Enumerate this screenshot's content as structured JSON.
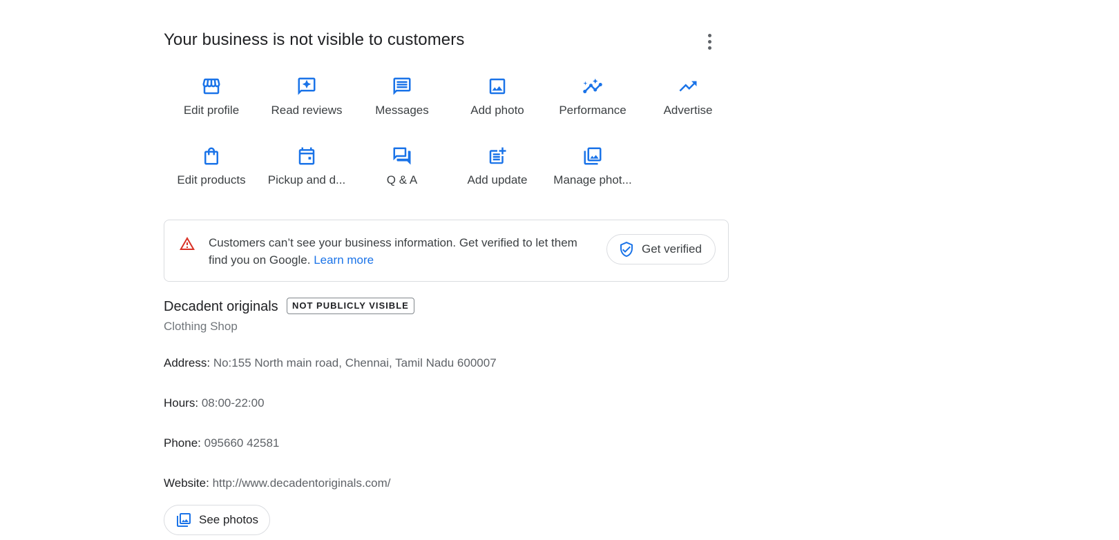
{
  "header": {
    "title": "Your business is not visible to customers",
    "more_icon": "more-vert-icon"
  },
  "actions": [
    {
      "label": "Edit profile",
      "icon": "storefront-icon"
    },
    {
      "label": "Read reviews",
      "icon": "review-star-icon"
    },
    {
      "label": "Messages",
      "icon": "message-icon"
    },
    {
      "label": "Add photo",
      "icon": "image-icon"
    },
    {
      "label": "Performance",
      "icon": "insights-icon"
    },
    {
      "label": "Advertise",
      "icon": "trending-up-icon"
    },
    {
      "label": "Edit products",
      "icon": "shopping-bag-icon"
    },
    {
      "label": "Pickup and d...",
      "icon": "calendar-icon"
    },
    {
      "label": "Q & A",
      "icon": "forum-icon"
    },
    {
      "label": "Add update",
      "icon": "post-add-icon"
    },
    {
      "label": "Manage phot...",
      "icon": "photo-library-icon"
    }
  ],
  "alert": {
    "message": "Customers can’t see your business information. Get verified to let them find you on Google.",
    "link_text": "Learn more",
    "button_label": "Get verified",
    "warning_icon": "warning-icon",
    "button_icon": "verified-shield-icon"
  },
  "business": {
    "name": "Decadent originals",
    "badge": "NOT PUBLICLY VISIBLE",
    "category": "Clothing Shop"
  },
  "info": [
    {
      "label": "Address:",
      "value": "No:155 North main road, Chennai, Tamil Nadu 600007"
    },
    {
      "label": "Hours:",
      "value": "08:00-22:00"
    },
    {
      "label": "Phone:",
      "value": "095660 42581"
    },
    {
      "label": "Website:",
      "value": "http://www.decadentoriginals.com/"
    }
  ],
  "photos_button": {
    "label": "See photos",
    "icon": "photo-library-icon"
  },
  "colors": {
    "accent": "#1a73e8",
    "warning": "#d93025",
    "text": "#202124",
    "muted": "#5f6368"
  }
}
